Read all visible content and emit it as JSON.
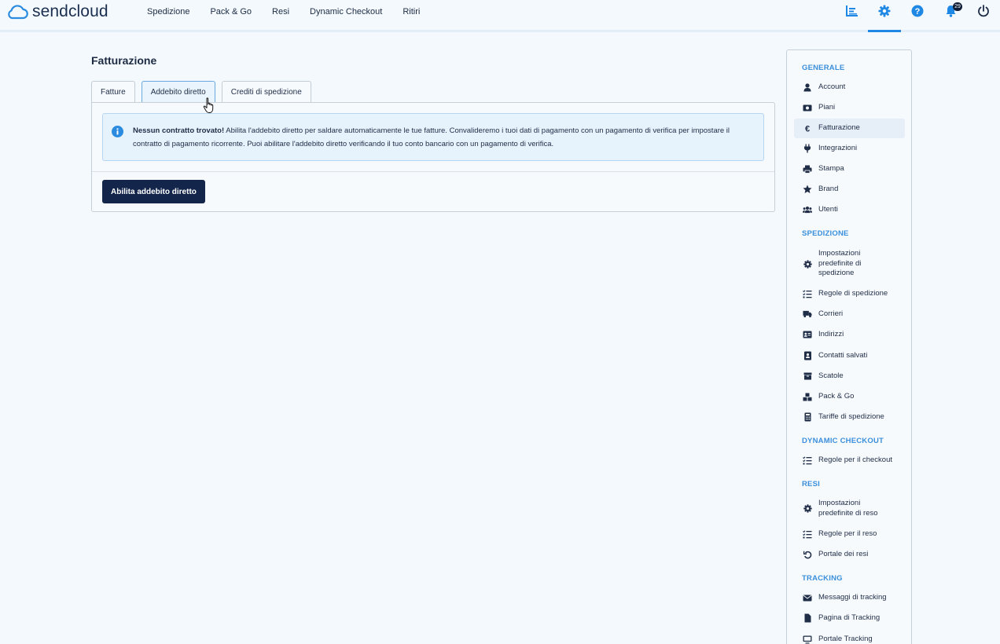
{
  "header": {
    "logo_text": "sendcloud",
    "nav": [
      "Spedizione",
      "Pack & Go",
      "Resi",
      "Dynamic Checkout",
      "Ritiri"
    ],
    "icons": [
      "analytics-icon",
      "settings-icon",
      "help-icon",
      "notifications-icon",
      "power-icon"
    ],
    "notifications_count": "29",
    "accent": "#1f88e5"
  },
  "main": {
    "title": "Fatturazione",
    "tabs": [
      "Fatture",
      "Addebito diretto",
      "Crediti di spedizione"
    ],
    "active_tab": "Addebito diretto",
    "alert": {
      "title": "Nessun contratto trovato!",
      "body": " Abilita l'addebito diretto per saldare automaticamente le tue fatture. Convalideremo i tuoi dati di pagamento con un pagamento di verifica per impostare il contratto di pagamento ricorrente. Puoi abilitare l'addebito diretto verificando il tuo conto bancario con un pagamento di verifica."
    },
    "button_label": "Abilita addebito diretto"
  },
  "sidebar": {
    "sections": [
      "GENERALE",
      "SPEDIZIONE",
      "DYNAMIC CHECKOUT",
      "RESI",
      "TRACKING"
    ],
    "generale": [
      "Account",
      "Piani",
      "Fatturazione",
      "Integrazioni",
      "Stampa",
      "Brand",
      "Utenti"
    ],
    "spedizione": [
      "Impostazioni predefinite di spedizione",
      "Regole di spedizione",
      "Corrieri",
      "Indirizzi",
      "Contatti salvati",
      "Scatole",
      "Pack & Go",
      "Tariffe di spedizione"
    ],
    "dynamic_checkout": [
      "Regole per il checkout"
    ],
    "resi": [
      "Impostazioni predefinite di reso",
      "Regole per il reso",
      "Portale dei resi"
    ],
    "tracking": [
      "Messaggi di tracking",
      "Pagina di Tracking",
      "Portale Tracking"
    ],
    "active_item": "Fatturazione"
  }
}
